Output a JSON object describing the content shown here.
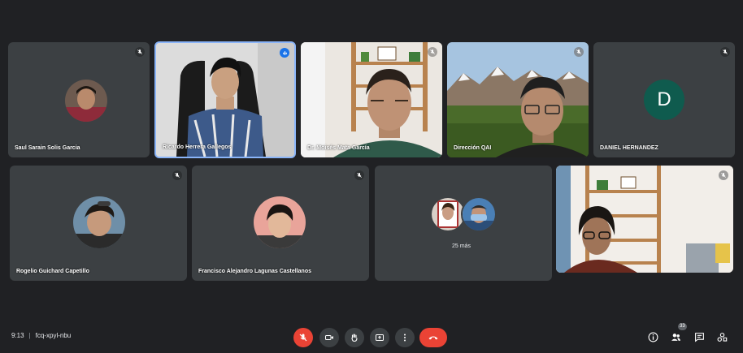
{
  "meeting": {
    "time": "9:13",
    "code": "fcq-xpyl-nbu",
    "participant_count": "33"
  },
  "participants": [
    {
      "name": "Saul Sarain Solis Garcia",
      "muted": true
    },
    {
      "name": "Ricardo Herrera Gallegos",
      "muted": false,
      "speaking": true
    },
    {
      "name": "Dr. Moisés Mata García",
      "muted": true
    },
    {
      "name": "Dirección QAI",
      "muted": true
    },
    {
      "name": "DANIEL HERNANDEZ",
      "muted": true,
      "avatar_letter": "D",
      "avatar_color": "#0f5b4e"
    },
    {
      "name": "Rogelio Guichard Capetillo",
      "muted": true
    },
    {
      "name": "Francisco Alejandro Lagunas Castellanos",
      "muted": true
    },
    {
      "name": "",
      "muted": true
    },
    {
      "name": "",
      "muted": true
    }
  ],
  "more_tile": {
    "label": "25 más"
  },
  "colors": {
    "end_call": "#ea4335",
    "tile": "#3c4043",
    "background": "#202124",
    "speaking_border": "#8ab4f8"
  },
  "controls": [
    "mic-off",
    "camera",
    "raise-hand",
    "present",
    "more-options",
    "end-call"
  ],
  "side_controls": [
    "info",
    "people",
    "chat",
    "activities"
  ]
}
